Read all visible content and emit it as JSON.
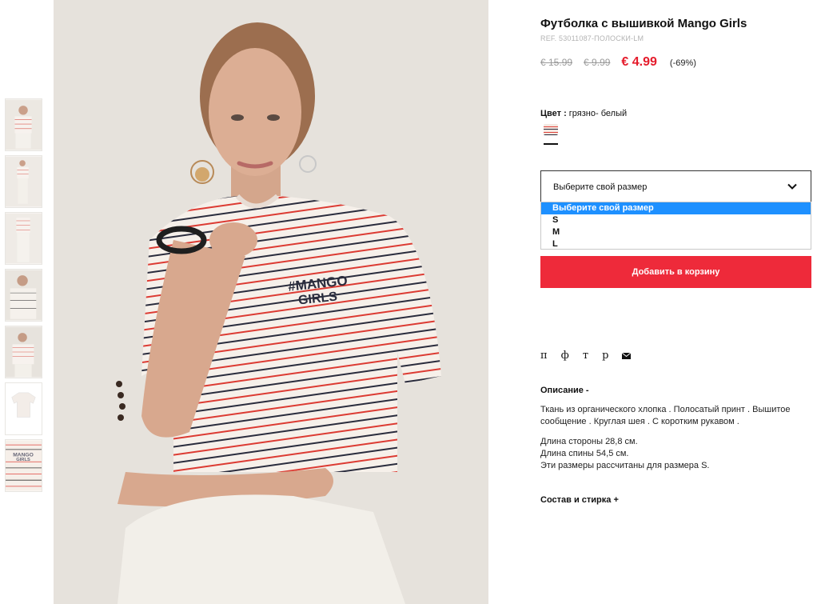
{
  "product": {
    "title": "Футболка с вышивкой Mango Girls",
    "ref": "REF. 53011087-ПОЛОСКИ-LM",
    "old_price_1": "€ 15.99",
    "old_price_2": "€ 9.99",
    "price": "€ 4.99",
    "discount": "(-69%)",
    "image_print": [
      "#MANGO",
      "GIRLS"
    ]
  },
  "color": {
    "label": "Цвет :",
    "value": "грязно- белый",
    "swatch_colors": [
      "#f3e8e2",
      "#e0463e",
      "#2a2a3a"
    ]
  },
  "size": {
    "placeholder": "Выберите свой размер",
    "options": [
      "Выберите свой размер",
      "S",
      "M",
      "L"
    ],
    "selected_index": 0
  },
  "cart": {
    "button_label": "Добавить в корзину"
  },
  "share": {
    "icons": [
      "п",
      "ф",
      "т",
      "р"
    ],
    "mail_icon": "mail-icon"
  },
  "description": {
    "heading": "Описание",
    "toggle": "-",
    "text": "Ткань из органического хлопка . Полосатый принт . Вышитое сообщение . Круглая шея . С коротким рукавом .",
    "measure_1": "Длина стороны 28,8 см.",
    "measure_2": "Длина спины 54,5 см.",
    "measure_3": "Эти размеры рассчитаны для размера S."
  },
  "composition": {
    "heading": "Состав и стирка",
    "toggle": "+"
  },
  "thumbnails": [
    "thumb-front",
    "thumb-full",
    "thumb-pants",
    "thumb-close",
    "thumb-model-selected",
    "thumb-flat",
    "thumb-detail"
  ],
  "colors": {
    "accent": "#ee2a3a",
    "price": "#e51c2c",
    "select_highlight": "#1e90ff"
  }
}
